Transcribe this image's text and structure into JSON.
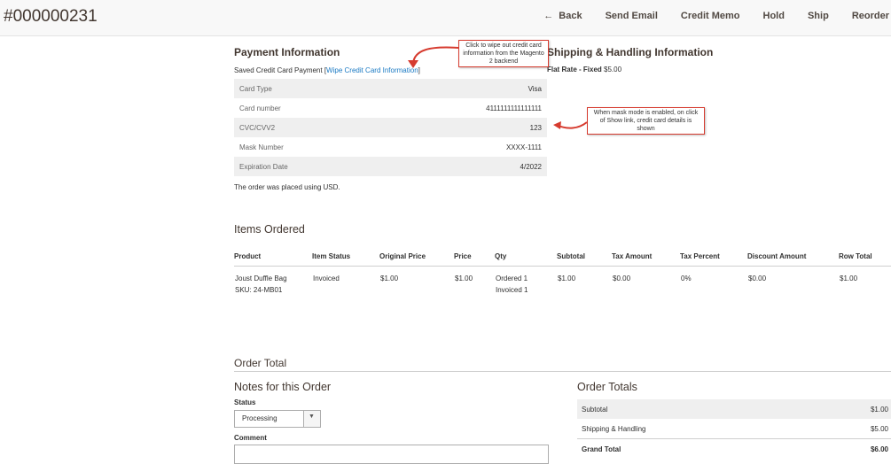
{
  "header": {
    "order_id": "#000000231",
    "actions": {
      "back": "Back",
      "send_email": "Send Email",
      "credit_memo": "Credit Memo",
      "hold": "Hold",
      "ship": "Ship",
      "reorder": "Reorder"
    }
  },
  "payment": {
    "title": "Payment Information",
    "saved_prefix": "Saved  Credit Card Payment [",
    "wipe_link": "Wipe Credit Card Information",
    "saved_suffix": "]",
    "rows": [
      {
        "label": "Card Type",
        "value": "Visa"
      },
      {
        "label": "Card number",
        "value": "4111111111111111"
      },
      {
        "label": "CVC/CVV2",
        "value": "123"
      },
      {
        "label": "Mask Number",
        "value": "XXXX-1111"
      },
      {
        "label": "Expiration Date",
        "value": "4/2022"
      }
    ],
    "currency_note": "The order was placed using USD."
  },
  "shipping": {
    "title": "Shipping & Handling Information",
    "method_label": "Flat Rate - Fixed",
    "method_price": "$5.00"
  },
  "annotations": {
    "wipe": "Click to wipe out credit card information from the Magento 2 backend",
    "mask": "When mask mode is enabled, on click of Show link, credit card details is shown",
    "color": "#d63b2f"
  },
  "items": {
    "title": "Items Ordered",
    "headers": [
      "Product",
      "Item Status",
      "Original Price",
      "Price",
      "Qty",
      "Subtotal",
      "Tax Amount",
      "Tax Percent",
      "Discount Amount",
      "Row Total"
    ],
    "rows": [
      {
        "product": "Joust Duffle Bag",
        "sku": "SKU: 24-MB01",
        "status": "Invoiced",
        "original_price": "$1.00",
        "price": "$1.00",
        "qty_ordered": "Ordered 1",
        "qty_invoiced": "Invoiced 1",
        "subtotal": "$1.00",
        "tax_amount": "$0.00",
        "tax_percent": "0%",
        "discount": "$0.00",
        "row_total": "$1.00"
      }
    ]
  },
  "order_total": {
    "title": "Order Total",
    "notes_title": "Notes for this Order",
    "status_label": "Status",
    "status_value": "Processing",
    "comment_label": "Comment",
    "totals_title": "Order Totals",
    "totals": [
      {
        "label": "Subtotal",
        "value": "$1.00"
      },
      {
        "label": "Shipping & Handling",
        "value": "$5.00"
      },
      {
        "label": "Grand Total",
        "value": "$6.00"
      }
    ]
  }
}
